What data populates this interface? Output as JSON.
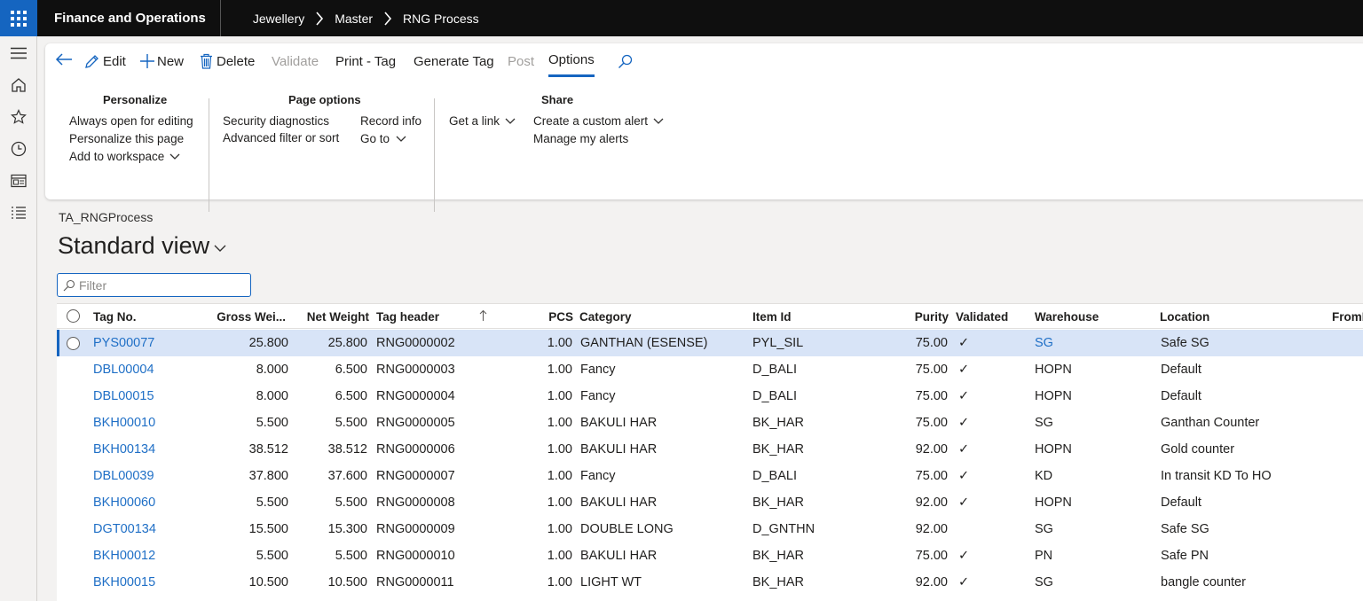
{
  "app": {
    "title": "Finance and Operations"
  },
  "breadcrumbs": [
    "Jewellery",
    "Master",
    "RNG Process"
  ],
  "toolbar": {
    "edit": "Edit",
    "new": "New",
    "delete": "Delete",
    "validate": "Validate",
    "print_tag": "Print - Tag",
    "generate_tag": "Generate Tag",
    "post": "Post",
    "options": "Options"
  },
  "groups": {
    "personalize": {
      "title": "Personalize",
      "items": [
        "Always open for editing",
        "Personalize this page",
        "Add to workspace"
      ]
    },
    "page_options": {
      "title": "Page options",
      "items": [
        "Security diagnostics",
        "Advanced filter or sort",
        "Record info",
        "Go to"
      ]
    },
    "share": {
      "title": "Share",
      "items": [
        "Get a link",
        "Create a custom alert",
        "Manage my alerts"
      ]
    }
  },
  "form": {
    "name": "TA_RNGProcess",
    "view": "Standard view",
    "filter_placeholder": "Filter"
  },
  "grid": {
    "columns": [
      "Tag No.",
      "Gross Wei...",
      "Net Weight",
      "Tag header",
      "PCS",
      "Category",
      "Item Id",
      "Purity",
      "Validated",
      "Warehouse",
      "Location",
      "FromI"
    ],
    "check": "✓",
    "rows": [
      {
        "tag": "PYS00077",
        "gross": "25.800",
        "net": "25.800",
        "header": "RNG0000002",
        "pcs": "1.00",
        "category": "GANTHAN (ESENSE)",
        "item": "PYL_SIL",
        "purity": "75.00",
        "validated": true,
        "warehouse": "SG",
        "warehouse_link": true,
        "location": "Safe SG"
      },
      {
        "tag": "DBL00004",
        "gross": "8.000",
        "net": "6.500",
        "header": "RNG0000003",
        "pcs": "1.00",
        "category": "Fancy",
        "item": "D_BALI",
        "purity": "75.00",
        "validated": true,
        "warehouse": "HOPN",
        "location": "Default"
      },
      {
        "tag": "DBL00015",
        "gross": "8.000",
        "net": "6.500",
        "header": "RNG0000004",
        "pcs": "1.00",
        "category": "Fancy",
        "item": "D_BALI",
        "purity": "75.00",
        "validated": true,
        "warehouse": "HOPN",
        "location": "Default"
      },
      {
        "tag": "BKH00010",
        "gross": "5.500",
        "net": "5.500",
        "header": "RNG0000005",
        "pcs": "1.00",
        "category": "BAKULI HAR",
        "item": "BK_HAR",
        "purity": "75.00",
        "validated": true,
        "warehouse": "SG",
        "location": "Ganthan Counter"
      },
      {
        "tag": "BKH00134",
        "gross": "38.512",
        "net": "38.512",
        "header": "RNG0000006",
        "pcs": "1.00",
        "category": "BAKULI HAR",
        "item": "BK_HAR",
        "purity": "92.00",
        "validated": true,
        "warehouse": "HOPN",
        "location": "Gold counter"
      },
      {
        "tag": "DBL00039",
        "gross": "37.800",
        "net": "37.600",
        "header": "RNG0000007",
        "pcs": "1.00",
        "category": "Fancy",
        "item": "D_BALI",
        "purity": "75.00",
        "validated": true,
        "warehouse": "KD",
        "location": "In transit KD To HO"
      },
      {
        "tag": "BKH00060",
        "gross": "5.500",
        "net": "5.500",
        "header": "RNG0000008",
        "pcs": "1.00",
        "category": "BAKULI HAR",
        "item": "BK_HAR",
        "purity": "92.00",
        "validated": true,
        "warehouse": "HOPN",
        "location": "Default"
      },
      {
        "tag": "DGT00134",
        "gross": "15.500",
        "net": "15.300",
        "header": "RNG0000009",
        "pcs": "1.00",
        "category": "DOUBLE LONG",
        "item": "D_GNTHN",
        "purity": "92.00",
        "validated": false,
        "warehouse": "SG",
        "location": "Safe SG"
      },
      {
        "tag": "BKH00012",
        "gross": "5.500",
        "net": "5.500",
        "header": "RNG0000010",
        "pcs": "1.00",
        "category": "BAKULI HAR",
        "item": "BK_HAR",
        "purity": "75.00",
        "validated": true,
        "warehouse": "PN",
        "location": "Safe PN"
      },
      {
        "tag": "BKH00015",
        "gross": "10.500",
        "net": "10.500",
        "header": "RNG0000011",
        "pcs": "1.00",
        "category": "LIGHT WT",
        "item": "BK_HAR",
        "purity": "92.00",
        "validated": true,
        "warehouse": "SG",
        "location": "bangle counter"
      }
    ]
  },
  "colors": {
    "accent": "#1565c0",
    "link": "#1f6fc6",
    "selected_row": "#d8e4f7",
    "topbar": "#0f0f0f"
  },
  "icons": [
    "waffle-icon",
    "chevron-right-icon",
    "hamburger-icon",
    "home-icon",
    "star-icon",
    "clock-icon",
    "workspace-icon",
    "list-icon",
    "back-arrow-icon",
    "pencil-icon",
    "plus-icon",
    "trash-icon",
    "search-icon",
    "chevron-down-icon",
    "sort-up-icon",
    "checkmark-icon"
  ]
}
